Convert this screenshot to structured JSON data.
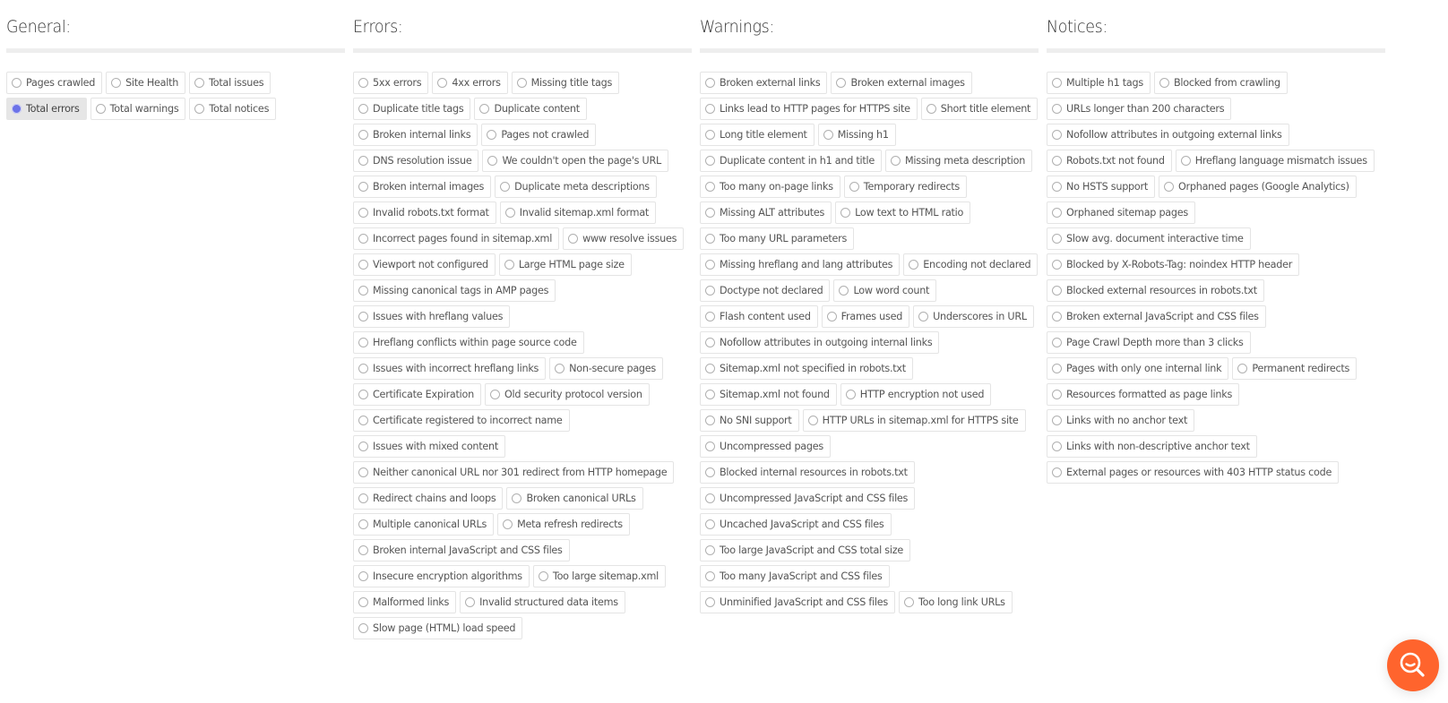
{
  "columns": [
    {
      "title": "General:",
      "items": [
        {
          "label": "Pages crawled",
          "selected": false
        },
        {
          "label": "Site Health",
          "selected": false
        },
        {
          "label": "Total issues",
          "selected": false
        },
        {
          "label": "Total errors",
          "selected": true
        },
        {
          "label": "Total warnings",
          "selected": false
        },
        {
          "label": "Total notices",
          "selected": false
        }
      ]
    },
    {
      "title": "Errors:",
      "items": [
        {
          "label": "5xx errors",
          "selected": false
        },
        {
          "label": "4xx errors",
          "selected": false
        },
        {
          "label": "Missing title tags",
          "selected": false
        },
        {
          "label": "Duplicate title tags",
          "selected": false
        },
        {
          "label": "Duplicate content",
          "selected": false
        },
        {
          "label": "Broken internal links",
          "selected": false
        },
        {
          "label": "Pages not crawled",
          "selected": false
        },
        {
          "label": "DNS resolution issue",
          "selected": false
        },
        {
          "label": "We couldn't open the page's URL",
          "selected": false
        },
        {
          "label": "Broken internal images",
          "selected": false
        },
        {
          "label": "Duplicate meta descriptions",
          "selected": false
        },
        {
          "label": "Invalid robots.txt format",
          "selected": false
        },
        {
          "label": "Invalid sitemap.xml format",
          "selected": false
        },
        {
          "label": "Incorrect pages found in sitemap.xml",
          "selected": false
        },
        {
          "label": "www resolve issues",
          "selected": false
        },
        {
          "label": "Viewport not configured",
          "selected": false
        },
        {
          "label": "Large HTML page size",
          "selected": false
        },
        {
          "label": "Missing canonical tags in AMP pages",
          "selected": false
        },
        {
          "label": "Issues with hreflang values",
          "selected": false
        },
        {
          "label": "Hreflang conflicts within page source code",
          "selected": false
        },
        {
          "label": "Issues with incorrect hreflang links",
          "selected": false
        },
        {
          "label": "Non-secure pages",
          "selected": false
        },
        {
          "label": "Certificate Expiration",
          "selected": false
        },
        {
          "label": "Old security protocol version",
          "selected": false
        },
        {
          "label": "Certificate registered to incorrect name",
          "selected": false
        },
        {
          "label": "Issues with mixed content",
          "selected": false
        },
        {
          "label": "Neither canonical URL nor 301 redirect from HTTP homepage",
          "selected": false
        },
        {
          "label": "Redirect chains and loops",
          "selected": false
        },
        {
          "label": "Broken canonical URLs",
          "selected": false
        },
        {
          "label": "Multiple canonical URLs",
          "selected": false
        },
        {
          "label": "Meta refresh redirects",
          "selected": false
        },
        {
          "label": "Broken internal JavaScript and CSS files",
          "selected": false
        },
        {
          "label": "Insecure encryption algorithms",
          "selected": false
        },
        {
          "label": "Too large sitemap.xml",
          "selected": false
        },
        {
          "label": "Malformed links",
          "selected": false
        },
        {
          "label": "Invalid structured data items",
          "selected": false
        },
        {
          "label": "Slow page (HTML) load speed",
          "selected": false
        }
      ]
    },
    {
      "title": "Warnings:",
      "items": [
        {
          "label": "Broken external links",
          "selected": false
        },
        {
          "label": "Broken external images",
          "selected": false
        },
        {
          "label": "Links lead to HTTP pages for HTTPS site",
          "selected": false
        },
        {
          "label": "Short title element",
          "selected": false
        },
        {
          "label": "Long title element",
          "selected": false
        },
        {
          "label": "Missing h1",
          "selected": false
        },
        {
          "label": "Duplicate content in h1 and title",
          "selected": false
        },
        {
          "label": "Missing meta description",
          "selected": false
        },
        {
          "label": "Too many on-page links",
          "selected": false
        },
        {
          "label": "Temporary redirects",
          "selected": false
        },
        {
          "label": "Missing ALT attributes",
          "selected": false
        },
        {
          "label": "Low text to HTML ratio",
          "selected": false
        },
        {
          "label": "Too many URL parameters",
          "selected": false
        },
        {
          "label": "Missing hreflang and lang attributes",
          "selected": false
        },
        {
          "label": "Encoding not declared",
          "selected": false
        },
        {
          "label": "Doctype not declared",
          "selected": false
        },
        {
          "label": "Low word count",
          "selected": false
        },
        {
          "label": "Flash content used",
          "selected": false
        },
        {
          "label": "Frames used",
          "selected": false
        },
        {
          "label": "Underscores in URL",
          "selected": false
        },
        {
          "label": "Nofollow attributes in outgoing internal links",
          "selected": false
        },
        {
          "label": "Sitemap.xml not specified in robots.txt",
          "selected": false
        },
        {
          "label": "Sitemap.xml not found",
          "selected": false
        },
        {
          "label": "HTTP encryption not used",
          "selected": false
        },
        {
          "label": "No SNI support",
          "selected": false
        },
        {
          "label": "HTTP URLs in sitemap.xml for HTTPS site",
          "selected": false
        },
        {
          "label": "Uncompressed pages",
          "selected": false
        },
        {
          "label": "Blocked internal resources in robots.txt",
          "selected": false
        },
        {
          "label": "Uncompressed JavaScript and CSS files",
          "selected": false
        },
        {
          "label": "Uncached JavaScript and CSS files",
          "selected": false
        },
        {
          "label": "Too large JavaScript and CSS total size",
          "selected": false
        },
        {
          "label": "Too many JavaScript and CSS files",
          "selected": false
        },
        {
          "label": "Unminified JavaScript and CSS files",
          "selected": false
        },
        {
          "label": "Too long link URLs",
          "selected": false
        }
      ]
    },
    {
      "title": "Notices:",
      "items": [
        {
          "label": "Multiple h1 tags",
          "selected": false
        },
        {
          "label": "Blocked from crawling",
          "selected": false
        },
        {
          "label": "URLs longer than 200 characters",
          "selected": false
        },
        {
          "label": "Nofollow attributes in outgoing external links",
          "selected": false
        },
        {
          "label": "Robots.txt not found",
          "selected": false
        },
        {
          "label": "Hreflang language mismatch issues",
          "selected": false
        },
        {
          "label": "No HSTS support",
          "selected": false
        },
        {
          "label": "Orphaned pages (Google Analytics)",
          "selected": false
        },
        {
          "label": "Orphaned sitemap pages",
          "selected": false
        },
        {
          "label": "Slow avg. document interactive time",
          "selected": false
        },
        {
          "label": "Blocked by X-Robots-Tag: noindex HTTP header",
          "selected": false
        },
        {
          "label": "Blocked external resources in robots.txt",
          "selected": false
        },
        {
          "label": "Broken external JavaScript and CSS files",
          "selected": false
        },
        {
          "label": "Page Crawl Depth more than 3 clicks",
          "selected": false
        },
        {
          "label": "Pages with only one internal link",
          "selected": false
        },
        {
          "label": "Permanent redirects",
          "selected": false
        },
        {
          "label": "Resources formatted as page links",
          "selected": false
        },
        {
          "label": "Links with no anchor text",
          "selected": false
        },
        {
          "label": "Links with non-descriptive anchor text",
          "selected": false
        },
        {
          "label": "External pages or resources with 403 HTTP status code",
          "selected": false
        }
      ]
    }
  ],
  "fab": {
    "icon": "search-assistant-icon",
    "color": "#ff642d"
  },
  "colors": {
    "selected_radio": "#6b72e8",
    "selected_chip_bg": "#e6e6e6"
  }
}
